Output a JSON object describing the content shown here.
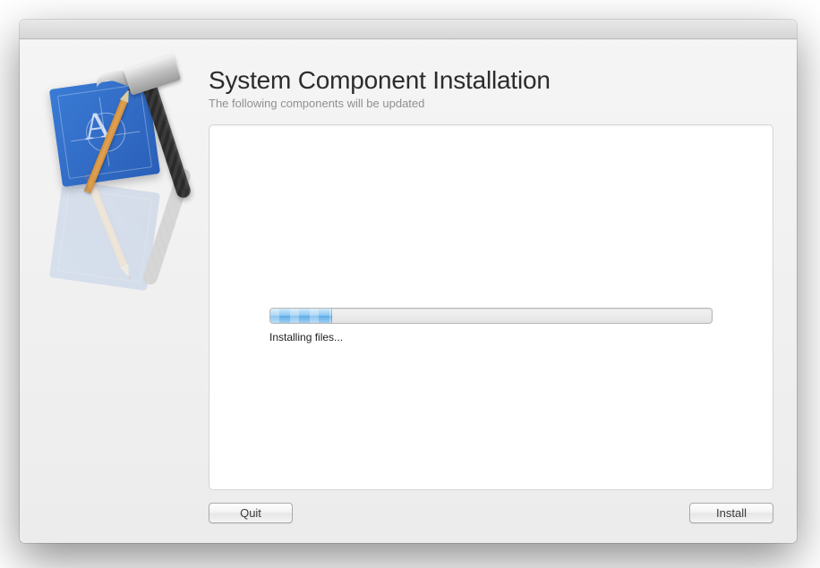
{
  "header": {
    "title": "System Component Installation",
    "subtitle": "The following components will be updated"
  },
  "progress": {
    "percent": 14,
    "status_text": "Installing files..."
  },
  "buttons": {
    "quit_label": "Quit",
    "install_label": "Install"
  },
  "icon_name": "xcode-blueprint-hammer-icon"
}
